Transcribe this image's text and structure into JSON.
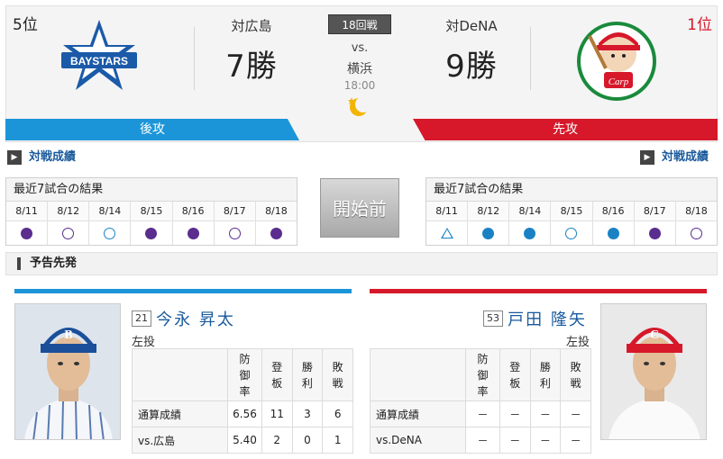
{
  "header": {
    "left_rank": "5位",
    "right_rank": "1位",
    "left_vs": "対広島",
    "left_wins": "7勝",
    "right_vs": "対DeNA",
    "right_wins": "9勝",
    "game_num": "18回戦",
    "vs": "vs.",
    "venue": "横浜",
    "time": "18:00",
    "left_order": "後攻",
    "right_order": "先攻",
    "left_logo_text": "BAYSTARS",
    "right_logo_text": "Carp",
    "icon_night": "moon-icon"
  },
  "h2h": {
    "left_link": "対戦成績",
    "right_link": "対戦成績"
  },
  "recent_left": {
    "title": "最近7試合の結果",
    "dates": [
      "8/11",
      "8/12",
      "8/14",
      "8/15",
      "8/16",
      "8/17",
      "8/18"
    ],
    "marks": [
      "purple",
      "purple-o",
      "blue-o",
      "purple",
      "purple",
      "purple-o",
      "purple"
    ]
  },
  "recent_right": {
    "title": "最近7試合の結果",
    "dates": [
      "8/11",
      "8/12",
      "8/14",
      "8/15",
      "8/16",
      "8/17",
      "8/18"
    ],
    "marks": [
      "tri",
      "blue",
      "blue",
      "blue-o",
      "blue",
      "purple",
      "purple-o"
    ]
  },
  "status": "開始前",
  "section_title": "予告先発",
  "colors": {
    "blue": "#1c95d8",
    "red": "#d6182a",
    "link": "#1a5a9c"
  },
  "pitcher_left": {
    "number": "21",
    "name": "今永 昇太",
    "throws": "左投",
    "rows": [
      {
        "label": "通算成績",
        "vals": [
          "6.56",
          "11",
          "3",
          "6"
        ]
      },
      {
        "label": "vs.広島",
        "vals": [
          "5.40",
          "2",
          "0",
          "1"
        ]
      }
    ]
  },
  "pitcher_right": {
    "number": "53",
    "name": "戸田 隆矢",
    "throws": "左投",
    "rows": [
      {
        "label": "通算成績",
        "vals": [
          "－",
          "－",
          "－",
          "－"
        ]
      },
      {
        "label": "vs.DeNA",
        "vals": [
          "－",
          "－",
          "－",
          "－"
        ]
      }
    ]
  },
  "stat_headers": [
    "防御率",
    "登板",
    "勝利",
    "敗戦"
  ]
}
